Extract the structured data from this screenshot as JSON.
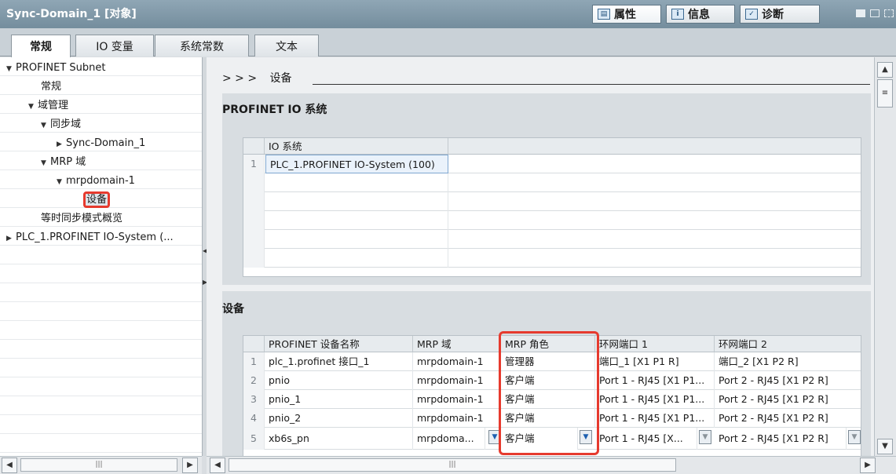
{
  "window": {
    "title": "Sync-Domain_1 [对象]"
  },
  "inspector_tabs": [
    {
      "label": "属性",
      "icon": "properties-icon"
    },
    {
      "label": "信息",
      "icon": "info-icon"
    },
    {
      "label": "诊断",
      "icon": "diagnostics-icon"
    }
  ],
  "tabs": [
    "常规",
    "IO 变量",
    "系统常数",
    "文本"
  ],
  "nav": {
    "root": "PROFINET Subnet",
    "general": "常规",
    "domain_mgmt": "域管理",
    "sync_domain": "同步域",
    "sync_domain_1": "Sync-Domain_1",
    "mrp_domain": "MRP 域",
    "mrpdomain_1": "mrpdomain-1",
    "devices": "设备",
    "iso_overview": "等时同步模式概览",
    "io_system": "PLC_1.PROFINET IO-System (..."
  },
  "breadcrumb": {
    "arrows": "> > >",
    "label": "设备"
  },
  "io_system_section": {
    "title": "PROFINET IO 系统",
    "header": "IO 系统",
    "rows": [
      {
        "num": "1",
        "name": "PLC_1.PROFINET IO-System (100)"
      }
    ]
  },
  "devices_section": {
    "title": "设备",
    "headers": [
      "PROFINET 设备名称",
      "MRP 域",
      "MRP 角色",
      "环网端口 1",
      "环网端口 2"
    ],
    "rows": [
      {
        "num": "1",
        "name": "plc_1.profinet 接口_1",
        "domain": "mrpdomain-1",
        "role": "管理器",
        "port1": "端口_1 [X1 P1 R]",
        "port2": "端口_2 [X1 P2 R]"
      },
      {
        "num": "2",
        "name": "pnio",
        "domain": "mrpdomain-1",
        "role": "客户端",
        "port1": "Port 1 - RJ45 [X1 P1...",
        "port2": "Port 2 - RJ45 [X1 P2 R]"
      },
      {
        "num": "3",
        "name": "pnio_1",
        "domain": "mrpdomain-1",
        "role": "客户端",
        "port1": "Port 1 - RJ45 [X1 P1...",
        "port2": "Port 2 - RJ45 [X1 P2 R]"
      },
      {
        "num": "4",
        "name": "pnio_2",
        "domain": "mrpdomain-1",
        "role": "客户端",
        "port1": "Port 1 - RJ45 [X1 P1...",
        "port2": "Port 2 - RJ45 [X1 P2 R]"
      },
      {
        "num": "5",
        "name": "xb6s_pn",
        "domain": "mrpdoma...",
        "role": "客户端",
        "port1": "Port 1 - RJ45 [X...",
        "port2": "Port 2 - RJ45 [X1 P2 R]"
      }
    ]
  },
  "colors": {
    "highlight": "#e63a2e",
    "titlebar": "#7d95a5"
  }
}
